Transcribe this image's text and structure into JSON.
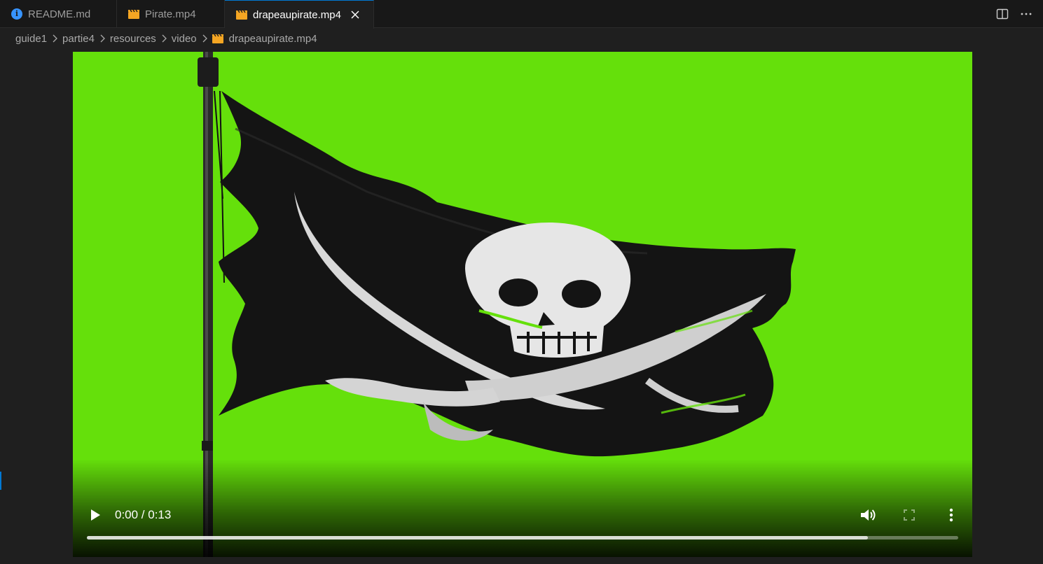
{
  "tabs": [
    {
      "label": "README.md",
      "icon": "info-icon"
    },
    {
      "label": "Pirate.mp4",
      "icon": "video-file-icon"
    },
    {
      "label": "drapeaupirate.mp4",
      "icon": "video-file-icon",
      "active": true
    }
  ],
  "breadcrumb": {
    "items": [
      "guide1",
      "partie4",
      "resources",
      "video"
    ],
    "file": "drapeaupirate.mp4"
  },
  "video": {
    "time": "0:00 / 0:13",
    "played_fraction": 0,
    "buffered_fraction": 0.896,
    "background_color": "#65e00b"
  },
  "colors": {
    "accent": "#0078d4",
    "file_icon": "#f5a623",
    "info_icon": "#3794ff"
  }
}
